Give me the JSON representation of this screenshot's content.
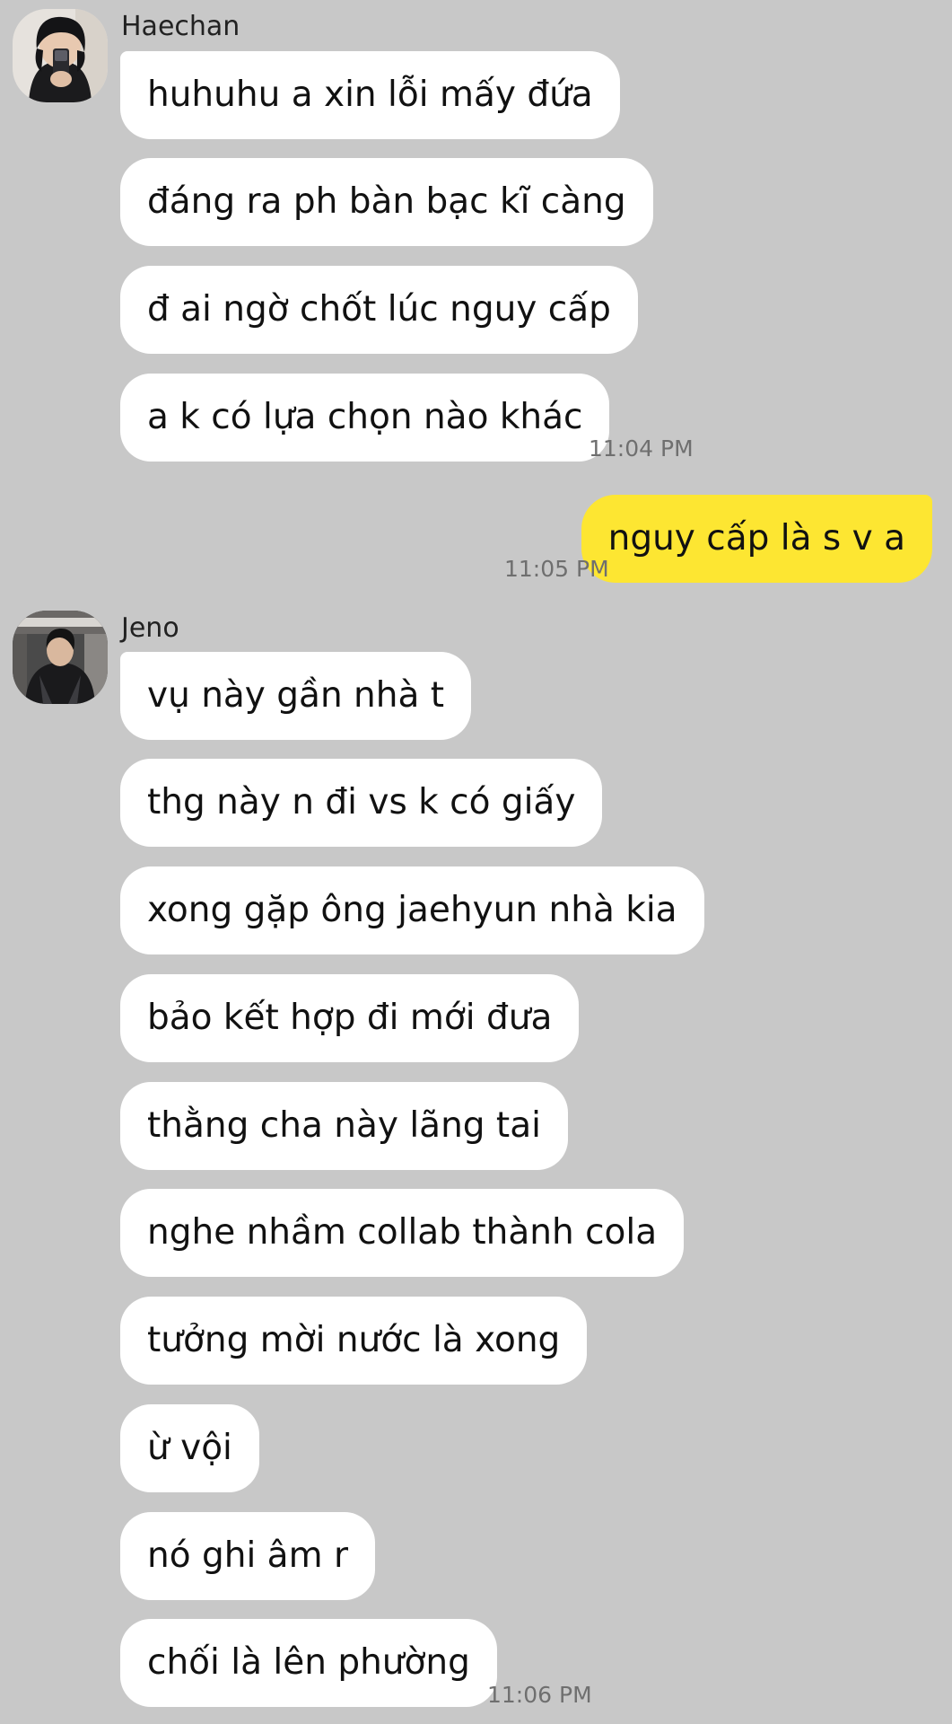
{
  "colors": {
    "background": "#c8c8c8",
    "incoming_bubble": "#ffffff",
    "outgoing_bubble": "#fde632",
    "timestamp": "#6f6f6f"
  },
  "groups": [
    {
      "sender": "Haechan",
      "avatar_icon": "profile-photo",
      "messages": [
        "huhuhu a xin lỗi mấy đứa",
        "đáng ra ph bàn bạc kĩ càng",
        "đ ai ngờ chốt lúc nguy cấp",
        "a k có lựa chọn nào khác"
      ],
      "time": "11:04 PM"
    },
    {
      "sender": "me",
      "messages": [
        "nguy cấp là s v a"
      ],
      "time": "11:05 PM"
    },
    {
      "sender": "Jeno",
      "avatar_icon": "profile-photo",
      "messages": [
        "vụ này gần nhà t",
        "thg này n đi vs k có giấy",
        "xong gặp ông jaehyun nhà kia",
        "bảo kết hợp đi mới đưa",
        "thằng cha này lãng tai",
        "nghe nhầm collab thành cola",
        "tưởng mời nước là xong",
        "ừ vội",
        "nó ghi âm r",
        "chối là lên phường"
      ],
      "time": "11:06 PM"
    }
  ]
}
